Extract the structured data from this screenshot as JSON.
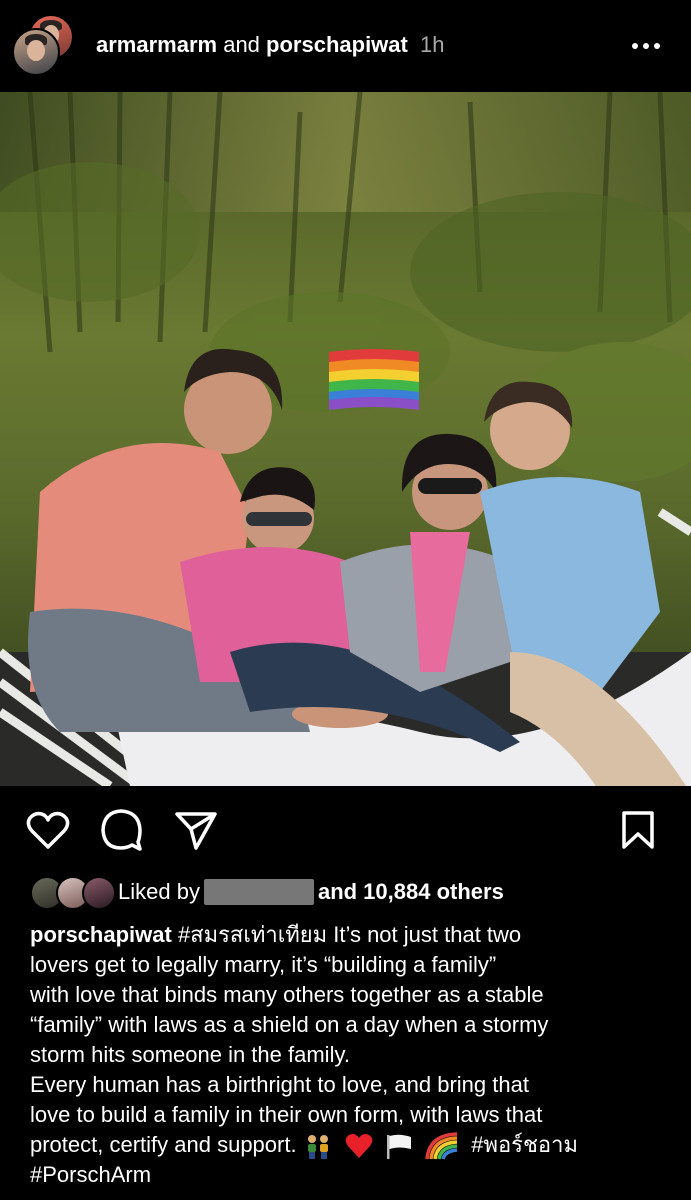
{
  "header": {
    "user1": "armarmarm",
    "conjunction": "and",
    "user2": "porschapiwat",
    "time": "1h"
  },
  "likes": {
    "prefix": "Liked by",
    "suffix": "and 10,884 others"
  },
  "caption": {
    "username": "porschapiwat",
    "line1": "#สมรสเท่าเทียม It’s not just that two",
    "line2": "lovers get to legally marry, it’s “building a family”",
    "line3": "with love that binds many others together as a stable",
    "line4": "“family” with laws as a shield on a day when a stormy",
    "line5": "storm hits someone in the family.",
    "line6": "Every human has a birthright to love, and bring that",
    "line7": "love to build a family in their own form, with laws that",
    "line8": "protect, certify and support.",
    "hashtag1": "#พอร์ชอาม",
    "hashtag2": "#PorschArm"
  },
  "colors": {
    "background": "#000000",
    "text": "#ffffff",
    "muted": "#a8a8a8",
    "redacted": "#777777"
  },
  "icons": [
    "heart-icon",
    "comment-icon",
    "share-icon",
    "bookmark-icon",
    "more-icon",
    "rainbow-flag-icon"
  ]
}
